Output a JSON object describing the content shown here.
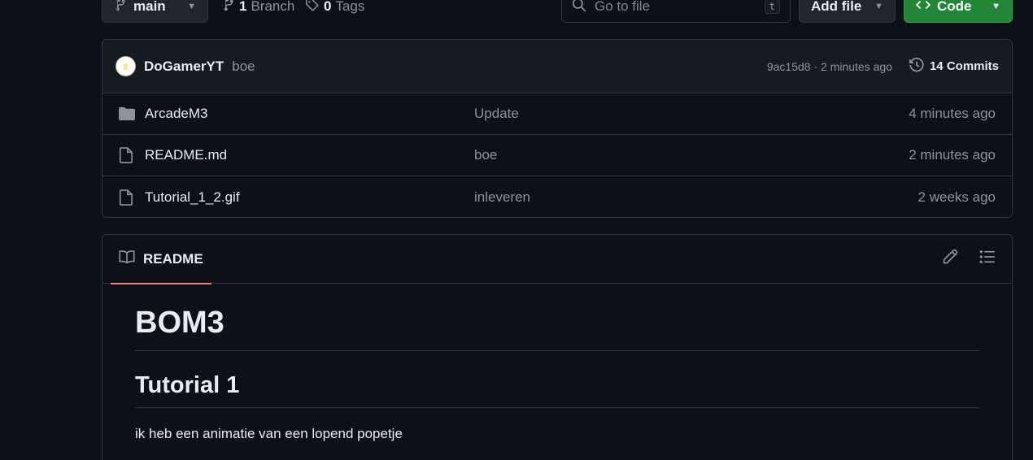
{
  "toolbar": {
    "branch_label": "main",
    "branches_count": "1",
    "branches_label": "Branch",
    "tags_count": "0",
    "tags_label": "Tags",
    "search_placeholder": "Go to file",
    "search_shortcut": "t",
    "add_file_label": "Add file",
    "code_label": "Code"
  },
  "commit": {
    "author": "DoGamerYT",
    "message": "boe",
    "meta": "9ac15d8 · 2 minutes ago",
    "commits_label": "14 Commits"
  },
  "files": [
    {
      "name": "ArcadeM3",
      "type": "folder",
      "message": "Update",
      "time": "4 minutes ago"
    },
    {
      "name": "README.md",
      "type": "file",
      "message": "boe",
      "time": "2 minutes ago"
    },
    {
      "name": "Tutorial_1_2.gif",
      "type": "file",
      "message": "inleveren",
      "time": "2 weeks ago"
    }
  ],
  "readme": {
    "tab_label": "README",
    "h1": "BOM3",
    "h2": "Tutorial 1",
    "paragraph": "ik heb een animatie van een lopend popetje"
  },
  "colors": {
    "background": "#0d1117",
    "code_button": "#238636",
    "tab_underline": "#f78166"
  }
}
